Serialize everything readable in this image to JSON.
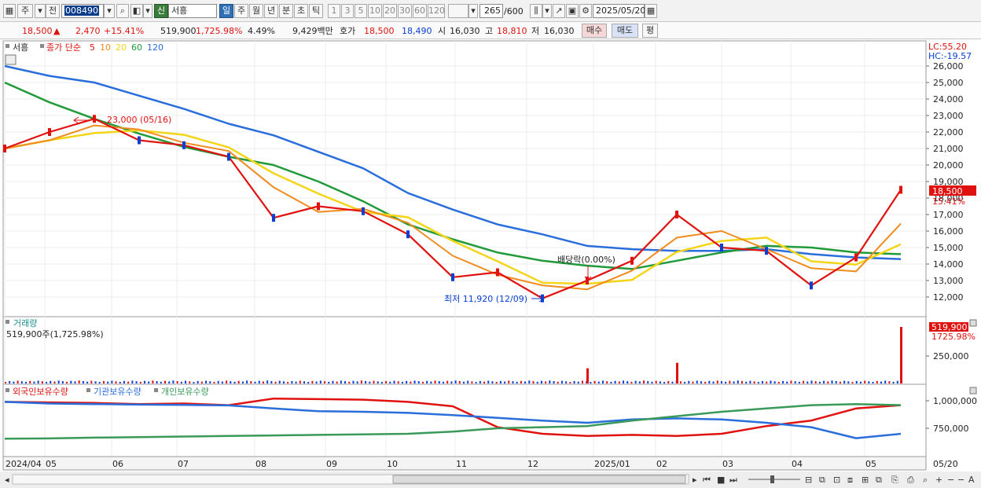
{
  "toolbar": {
    "market_label": "주",
    "prev_label": "전",
    "code": "008490",
    "new_badge": "신",
    "stock_name": "서흥",
    "periods": [
      "일",
      "주",
      "월",
      "년",
      "분",
      "초",
      "틱"
    ],
    "minute_units": [
      "1",
      "3",
      "5",
      "10",
      "20",
      "30",
      "60",
      "120"
    ],
    "count": "265",
    "total": "/600",
    "date": "2025/05/20"
  },
  "info": {
    "price": "18,500",
    "change_sign": "▲",
    "change": "2,470",
    "change_pct": "+15.41%",
    "volume": "519,900",
    "volume_pct": "1,725.98%",
    "turnover": "4.49%",
    "amount": "9,429백만",
    "hoga_label": "호가",
    "ask": "18,500",
    "bid": "18,490",
    "open_label": "시",
    "open": "16,030",
    "high_label": "고",
    "high": "18,810",
    "low_label": "저",
    "low": "16,030",
    "buy_label": "매수",
    "sell_label": "매도",
    "eval_label": "평"
  },
  "legend": {
    "name": "서흥",
    "price_label": "종가 단순",
    "mas": [
      {
        "label": "5",
        "color": "#e0120f"
      },
      {
        "label": "10",
        "color": "#f08c1e"
      },
      {
        "label": "20",
        "color": "#f3d51a"
      },
      {
        "label": "60",
        "color": "#219a3a"
      },
      {
        "label": "120",
        "color": "#2a6edb"
      }
    ],
    "lc": "LC:55.20",
    "hc": "HC:-19.57"
  },
  "colors": {
    "up": "#e0120f",
    "down": "#0a3fd4",
    "ma5": "#e0120f",
    "ma10": "#f08c1e",
    "ma20": "#f3d51a",
    "ma60": "#219a3a",
    "ma120": "#2a6edb",
    "foreign": "#e0120f",
    "inst": "#2a6edb",
    "indiv": "#3a9a5a"
  },
  "annotations": {
    "high_note": "23,000 (05/16)",
    "dividend_note": "배당락(0.00%)",
    "low_note": "최저 11,920 (12/09)"
  },
  "price_axis_labels": [
    "26,000",
    "25,000",
    "24,000",
    "23,000",
    "22,000",
    "21,000",
    "20,000",
    "19,000",
    "18,000",
    "17,000",
    "16,000",
    "15,000",
    "14,000",
    "13,000",
    "12,000"
  ],
  "current_price_tag": {
    "price": "18,500",
    "pct": "15.41%"
  },
  "volume_panel": {
    "title": "거래량",
    "value_text": "519,900주(1,725.98%)",
    "axis_label": "250,000",
    "tag_value": "519,900",
    "tag_pct": "1725.98%"
  },
  "holdings_panel": {
    "legend": [
      "외국인보유수량",
      "기관보유수량",
      "개인보유수량"
    ],
    "axis_labels": [
      "1,000,000",
      "750,000"
    ]
  },
  "x_axis_labels": [
    "2024/04",
    "05",
    "06",
    "07",
    "08",
    "09",
    "10",
    "11",
    "12",
    "2025/01",
    "02",
    "03",
    "04",
    "05"
  ],
  "x_axis_right_label": "05/20",
  "chart_data": {
    "type": "line",
    "title": "",
    "ylim": [
      11500,
      26500
    ],
    "x": [
      "2024/04",
      "2024/05",
      "2024/05/16",
      "2024/06",
      "2024/07",
      "2024/08",
      "2024/08-mid",
      "2024/09",
      "2024/10",
      "2024/11",
      "2024/11-mid",
      "2024/12",
      "2024/12/09",
      "2025/01",
      "2025/02",
      "2025/02-mid",
      "2025/03",
      "2025/04",
      "2025/04-mid",
      "2025/05",
      "2025/05/20"
    ],
    "series": [
      {
        "values": [
          21000,
          22000,
          22800,
          21500,
          21200,
          20500,
          16800,
          17500,
          17200,
          15800,
          13200,
          13500,
          11920,
          13000,
          14200,
          17000,
          15000,
          14800,
          12700,
          14400,
          18500
        ]
      },
      {
        "values": [
          26000,
          25400,
          25000,
          24200,
          23400,
          22500,
          21800,
          20800,
          19800,
          18300,
          17300,
          16400,
          15800,
          15100,
          14900,
          14800,
          14800,
          14900,
          14600,
          14400,
          14300
        ]
      },
      {
        "values": [
          25000,
          23800,
          22800,
          21900,
          21100,
          20500,
          20000,
          19000,
          17800,
          16400,
          15500,
          14700,
          14200,
          13900,
          13700,
          14200,
          14700,
          15100,
          15000,
          14700,
          14600
        ]
      }
    ],
    "volume": {
      "ylim": [
        0,
        520000
      ],
      "last_value": 519900,
      "spikes": [
        {
          "x": "2025/01",
          "value": 140000
        },
        {
          "x": "2025/02-mid",
          "value": 190000
        },
        {
          "x": "2025/05/20",
          "value": 519900
        }
      ]
    },
    "holdings": {
      "ylim": [
        620000,
        1060000
      ],
      "series": [
        {
          "name": "외국인보유수량",
          "values": [
            990000,
            985000,
            980000,
            970000,
            975000,
            960000,
            1020000,
            1015000,
            1010000,
            990000,
            950000,
            760000,
            700000,
            680000,
            690000,
            680000,
            700000,
            770000,
            820000,
            930000,
            960000
          ]
        },
        {
          "name": "기관보유수량",
          "values": [
            990000,
            975000,
            970000,
            965000,
            962000,
            958000,
            930000,
            905000,
            900000,
            890000,
            870000,
            845000,
            820000,
            800000,
            830000,
            840000,
            830000,
            800000,
            760000,
            660000,
            700000
          ]
        },
        {
          "name": "개인보유수량",
          "values": [
            655000,
            658000,
            665000,
            670000,
            675000,
            680000,
            685000,
            690000,
            695000,
            700000,
            720000,
            750000,
            760000,
            770000,
            820000,
            860000,
            900000,
            930000,
            960000,
            970000,
            960000
          ]
        }
      ]
    }
  }
}
